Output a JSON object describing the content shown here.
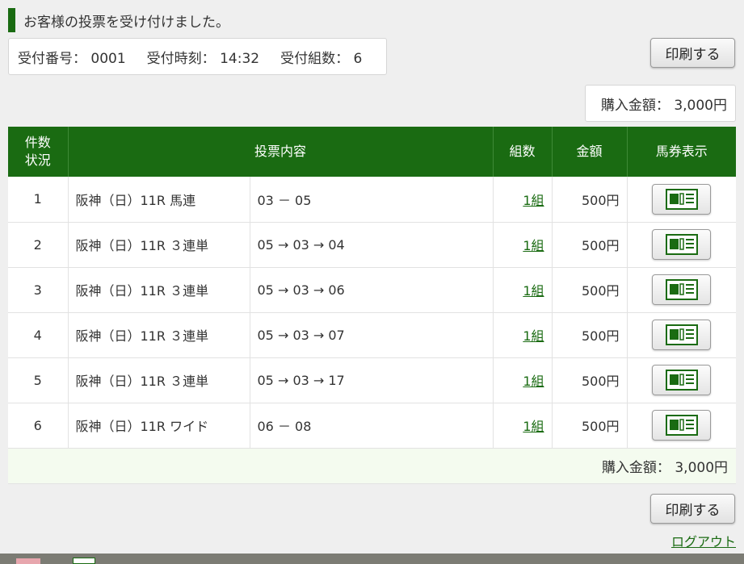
{
  "header": {
    "message": "お客様の投票を受け付けました。"
  },
  "receipt": {
    "number_label": "受付番号：",
    "number_value": "0001",
    "time_label": "受付時刻：",
    "time_value": "14:32",
    "count_label": "受付組数：",
    "count_value": "6"
  },
  "buttons": {
    "print": "印刷する",
    "logout": "ログアウト"
  },
  "total": {
    "label": "購入金額：",
    "value": "3,000円"
  },
  "table": {
    "headers": {
      "count_status_1": "件数",
      "count_status_2": "状況",
      "content": "投票内容",
      "kumi": "組数",
      "amount": "金額",
      "ticket": "馬券表示"
    },
    "rows": [
      {
        "no": "1",
        "race": "阪神（日）11R 馬連",
        "bet": "03 － 05",
        "kumi": "1組",
        "amount": "500円"
      },
      {
        "no": "2",
        "race": "阪神（日）11R ３連単",
        "bet": "05 → 03 → 04",
        "kumi": "1組",
        "amount": "500円"
      },
      {
        "no": "3",
        "race": "阪神（日）11R ３連単",
        "bet": "05 → 03 → 06",
        "kumi": "1組",
        "amount": "500円"
      },
      {
        "no": "4",
        "race": "阪神（日）11R ３連単",
        "bet": "05 → 03 → 07",
        "kumi": "1組",
        "amount": "500円"
      },
      {
        "no": "5",
        "race": "阪神（日）11R ３連単",
        "bet": "05 → 03 → 17",
        "kumi": "1組",
        "amount": "500円"
      },
      {
        "no": "6",
        "race": "阪神（日）11R ワイド",
        "bet": "06 － 08",
        "kumi": "1組",
        "amount": "500円"
      }
    ]
  },
  "icons": {
    "ticket_view": "ticket-icon"
  },
  "colors": {
    "accent": "#1a6b12",
    "total_row_bg": "#f4fbef",
    "page_bg": "#efefef"
  }
}
